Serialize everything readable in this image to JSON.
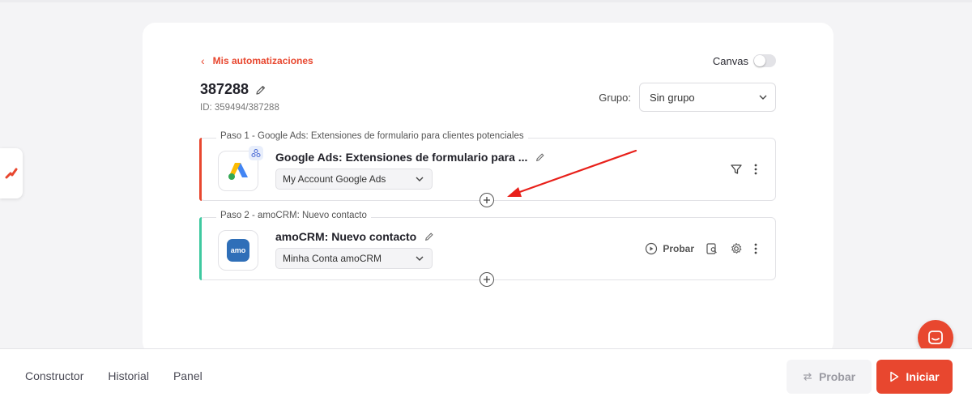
{
  "brand": {
    "accent": "#e8472f",
    "success": "#3ec9a0"
  },
  "header": {
    "back_label": "Mis automatizaciones",
    "title": "387288",
    "id_line": "ID: 359494/387288",
    "canvas_label": "Canvas",
    "canvas_enabled": false,
    "group_label": "Grupo:",
    "group_value": "Sin grupo"
  },
  "steps": [
    {
      "caption": "Paso 1 - Google Ads: Extensiones de formulario para clientes potenciales",
      "title": "Google Ads: Extensiones de formulario para ...",
      "account": "My Account Google Ads",
      "app_icon": "google-ads-icon",
      "badge_icon": "webhook-icon",
      "accent_color": "#e8472f"
    },
    {
      "caption": "Paso 2 - amoCRM: Nuevo contacto",
      "title": "amoCRM: Nuevo contacto",
      "account": "Minha Conta amoCRM",
      "app_icon": "amocrm-icon",
      "app_icon_text": "amo",
      "accent_color": "#3ec9a0",
      "probar_label": "Probar"
    }
  ],
  "bottom": {
    "tabs": [
      "Constructor",
      "Historial",
      "Panel"
    ],
    "probar_label": "Probar",
    "iniciar_label": "Iniciar"
  }
}
